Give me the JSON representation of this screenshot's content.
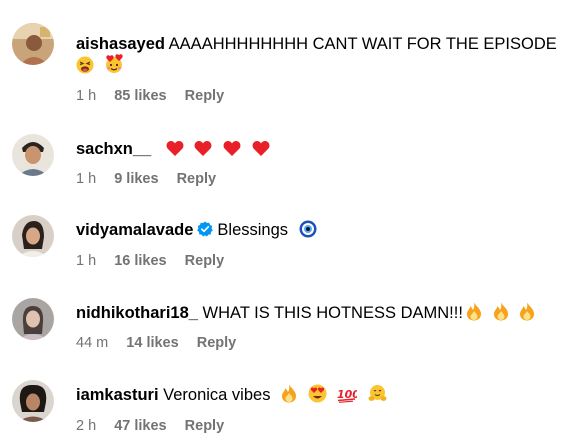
{
  "comments": [
    {
      "username": "aishasayed",
      "text": "AAAAHHHHHHHH CANT WAIT FOR THE EPISODE",
      "time": "1 h",
      "likes": "85 likes",
      "reply": "Reply",
      "emojis": [
        "tired-face-emoji",
        "face-with-hearts-emoji"
      ]
    },
    {
      "username": "sachxn__",
      "text": "",
      "time": "1 h",
      "likes": "9 likes",
      "reply": "Reply",
      "emojis": [
        "red-heart-emoji",
        "red-heart-emoji",
        "red-heart-emoji",
        "red-heart-emoji"
      ]
    },
    {
      "username": "vidyamalavade",
      "verified": true,
      "text": "Blessings",
      "time": "1 h",
      "likes": "16 likes",
      "reply": "Reply",
      "emojis": [
        "nazar-amulet-emoji"
      ]
    },
    {
      "username": "nidhikothari18_",
      "text": "WHAT IS THIS HOTNESS DAMN!!!",
      "time": "44 m",
      "likes": "14 likes",
      "reply": "Reply",
      "emojis": [
        "fire-emoji",
        "fire-emoji",
        "fire-emoji"
      ]
    },
    {
      "username": "iamkasturi",
      "text": "Veronica vibes",
      "time": "2 h",
      "likes": "47 likes",
      "reply": "Reply",
      "emojis": [
        "fire-emoji",
        "heart-eyes-emoji",
        "hundred-points-emoji",
        "hugging-face-emoji"
      ]
    }
  ],
  "colors": {
    "text": "#000000",
    "meta": "#737373",
    "verified": "#0095f6",
    "heart": "#e8202a",
    "fire": "#f7a21b"
  }
}
